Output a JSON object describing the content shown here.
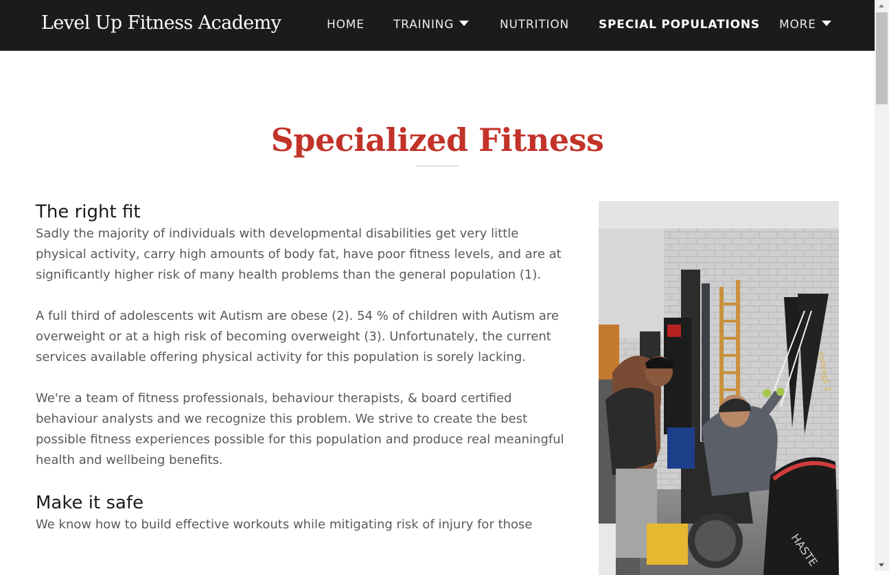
{
  "site": {
    "brand": "Level Up Fitness Academy"
  },
  "nav": {
    "items": [
      {
        "label": "HOME",
        "dropdown": false,
        "active": false
      },
      {
        "label": "TRAINING",
        "dropdown": true,
        "active": false
      },
      {
        "label": "NUTRITION",
        "dropdown": false,
        "active": false
      },
      {
        "label": "SPECIAL POPULATIONS",
        "dropdown": false,
        "active": true
      },
      {
        "label": "MORE",
        "dropdown": true,
        "active": false
      }
    ]
  },
  "main": {
    "title": "Specialized Fitness",
    "sections": [
      {
        "heading": "The right fit",
        "paragraphs": [
          "Sadly the majority of individuals with developmental disabilities get very little physical activity, carry high amounts of body fat, have poor fitness levels, and are at significantly higher risk of many health problems than the general population (1).",
          "A full third of adolescents wit Autism are obese (2). 54 % of children with Autism are overweight or at a high risk of becoming overweight (3). Unfortunately, the current services available offering physical activity for this population is sorely lacking.",
          "We're a team of fitness professionals, behaviour therapists, & board certified behaviour analysts and we recognize this problem. We strive to create the best possible fitness experiences possible for this population and produce real meaningful health and wellbeing benefits."
        ]
      },
      {
        "heading": "Make it safe",
        "paragraphs": [
          "We know how to build effective workouts while mitigating risk of injury for those"
        ]
      }
    ],
    "photo": {
      "machine_brand": "concept 2",
      "machine_logo": "C2",
      "bike_label": "HASTE"
    }
  },
  "colors": {
    "nav_bg": "#1b1b1b",
    "title": "#c23329",
    "body_text": "#595959",
    "heading_text": "#1b1b1b"
  }
}
